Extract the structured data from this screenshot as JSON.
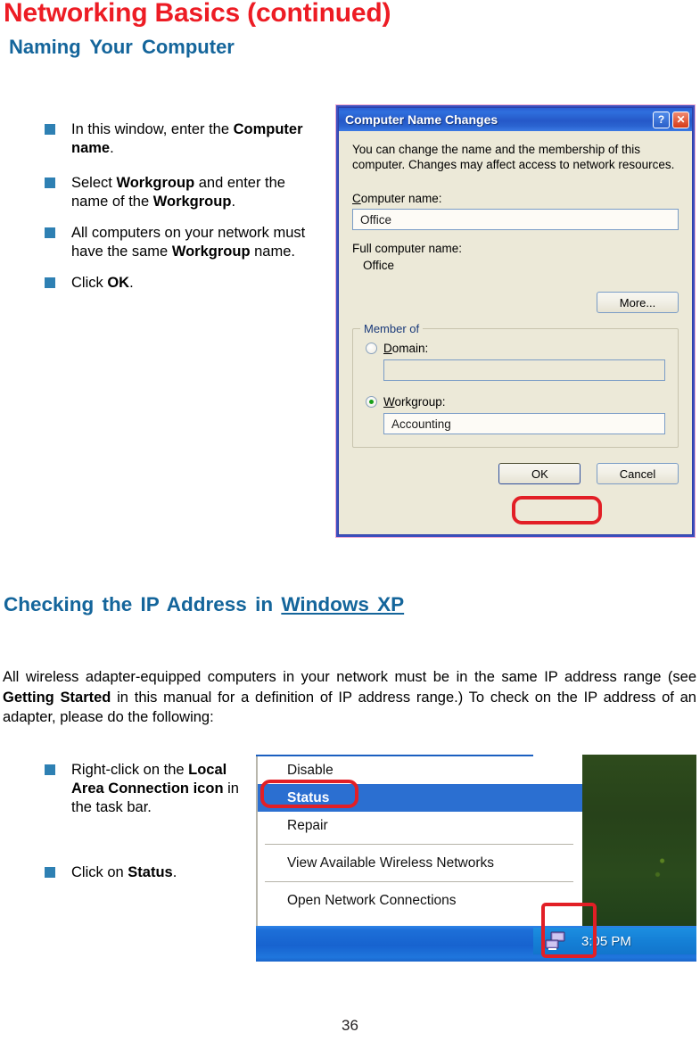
{
  "header": {
    "title": "Networking Basics (continued)",
    "subtitle": "Naming Your Computer",
    "title_color": "#ed1c24",
    "subtitle_color": "#14659b"
  },
  "bullets_top": [
    {
      "parts": [
        {
          "t": "In this window, enter the ",
          "b": false
        },
        {
          "t": "Computer name",
          "b": true
        },
        {
          "t": ".",
          "b": false
        }
      ]
    },
    {
      "parts": [
        {
          "t": "Select ",
          "b": false
        },
        {
          "t": "Workgroup",
          "b": true
        },
        {
          "t": " and enter the name of the ",
          "b": false
        },
        {
          "t": "Workgroup",
          "b": true
        },
        {
          "t": ".",
          "b": false
        }
      ]
    },
    {
      "parts": [
        {
          "t": "All computers on your network must have the same ",
          "b": false
        },
        {
          "t": "Workgroup",
          "b": true
        },
        {
          "t": " name.",
          "b": false
        }
      ]
    },
    {
      "parts": [
        {
          "t": "Click ",
          "b": false
        },
        {
          "t": "OK",
          "b": true
        },
        {
          "t": ".",
          "b": false
        }
      ]
    }
  ],
  "dialog": {
    "title": "Computer Name Changes",
    "help_button": "?",
    "close_button": "✕",
    "description": "You can change the name and the membership of this computer. Changes may affect access to network resources.",
    "computer_name_label": "Computer name:",
    "computer_name_value": "Office",
    "full_computer_name_label": "Full computer name:",
    "full_computer_name_value": "Office",
    "more_button": "More...",
    "member_of_legend": "Member of",
    "domain_label": "Domain:",
    "domain_value": "",
    "domain_selected": false,
    "workgroup_label": "Workgroup:",
    "workgroup_value": "Accounting",
    "workgroup_selected": true,
    "ok_button": "OK",
    "cancel_button": "Cancel",
    "highlight_color": "#e21f26",
    "titlebar_color": "#2558c8",
    "face_color": "#ece9d8"
  },
  "section": {
    "heading_plain": "Checking the IP Address in ",
    "heading_underlined": "Windows XP",
    "paragraph_parts": [
      {
        "t": "All wireless adapter-equipped computers in your network must be in the same IP address range (see ",
        "b": false
      },
      {
        "t": "Getting Started",
        "b": true
      },
      {
        "t": " in this manual for a definition of IP address range.) To check on the IP address of an adapter, please do the following:",
        "b": false
      }
    ]
  },
  "bullets_bottom": [
    {
      "parts": [
        {
          "t": "Right-click on the ",
          "b": false
        },
        {
          "t": "Local Area Connection icon",
          "b": true
        },
        {
          "t": " in the task bar.",
          "b": false
        }
      ]
    },
    {
      "parts": [
        {
          "t": "Click on ",
          "b": false
        },
        {
          "t": "Status",
          "b": true
        },
        {
          "t": ".",
          "b": false
        }
      ]
    }
  ],
  "context_menu": {
    "items": [
      {
        "label": "Disable",
        "selected": false,
        "separator_after": false
      },
      {
        "label": "Status",
        "selected": true,
        "separator_after": false
      },
      {
        "label": "Repair",
        "selected": false,
        "separator_after": true
      },
      {
        "label": "View Available Wireless Networks",
        "selected": false,
        "separator_after": true
      },
      {
        "label": "Open Network Connections",
        "selected": false,
        "separator_after": false
      }
    ],
    "taskbar_clock": "3:05 PM",
    "tray_icon": "network-connection-icon",
    "selection_color": "#2b6fd1",
    "highlight_color": "#e21f26"
  },
  "footer": {
    "page_number": "36"
  }
}
